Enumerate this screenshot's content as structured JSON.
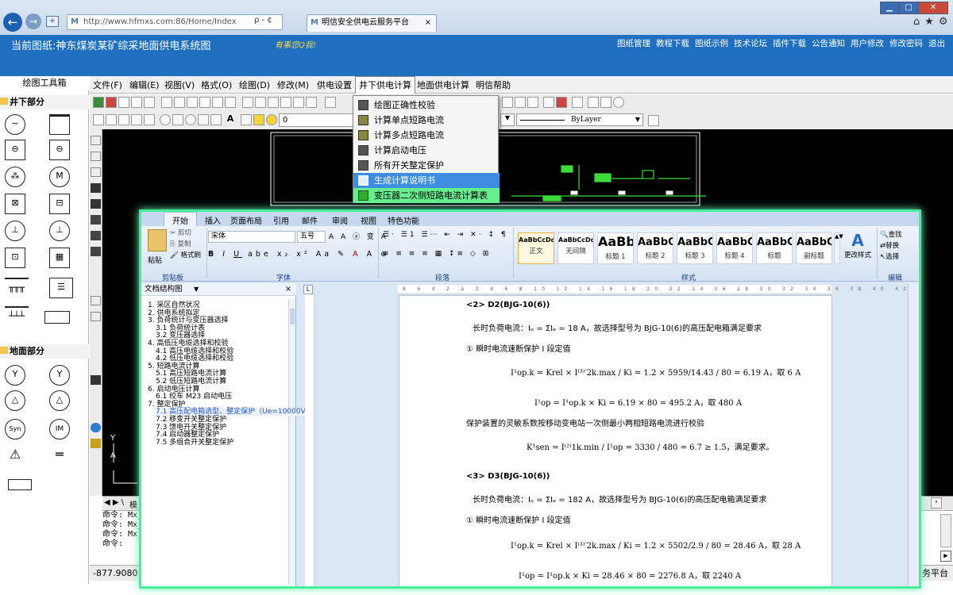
{
  "browser": {
    "url": "http://www.hfmxs.com:86/Home/Index",
    "tab_title": "明信安全供电云服务平台",
    "tab_close": "×",
    "search_glyph": "ρ - ¢"
  },
  "site": {
    "title": "当前图纸:神东煤炭某矿综采地面供电系统图",
    "logo_text": "有事您Q我!",
    "nav": [
      "图纸管理",
      "教程下载",
      "图纸示例",
      "技术论坛",
      "插件下载",
      "公告通知",
      "用户修改",
      "修改密码",
      "退出"
    ]
  },
  "left_panel": {
    "title": "绘图工具箱",
    "section1": "井下部分",
    "section2": "地面部分",
    "symbol_labels": [
      "M",
      "Syn",
      "IM"
    ]
  },
  "cad": {
    "menus": [
      "文件(F)",
      "编辑(E)",
      "视图(V)",
      "格式(O)",
      "绘图(D)",
      "修改(M)",
      "供电设置",
      "井下供电计算",
      "地面供电计算",
      "明信帮助"
    ],
    "layer_value": "0",
    "linetype_value": "ByLayer",
    "dropdown_items": [
      "绘图正确性校验",
      "计算单点短路电流",
      "计算多点短路电流",
      "计算启动电压",
      "所有开关整定保护",
      "生成计算说明书",
      "变压器二次侧短路电流计算表"
    ],
    "selected_item": "生成计算说明书",
    "command_lines": [
      "命令: Mx_",
      "命令: Mx_",
      "命令: Mx_",
      "命令:"
    ],
    "coordinates": "-877.9080",
    "status_right": "服务平台",
    "model_tab": "模"
  },
  "word": {
    "tabs": [
      "开始",
      "插入",
      "页面布局",
      "引用",
      "邮件",
      "审阅",
      "视图",
      "特色功能"
    ],
    "clipboard": {
      "cut": "剪切",
      "copy": "复制",
      "paste": "粘贴",
      "format_painter": "格式刷",
      "group": "剪贴板"
    },
    "font": {
      "name": "宋体",
      "size": "五号",
      "group": "字体"
    },
    "paragraph_group": "段落",
    "styles": [
      {
        "preview": "AaBbCcDd",
        "name": "正文"
      },
      {
        "preview": "AaBbCcDd",
        "name": "无间隔"
      },
      {
        "preview": "AaBb",
        "name": "标题 1"
      },
      {
        "preview": "AaBbC",
        "name": "标题 2"
      },
      {
        "preview": "AaBbC",
        "name": "标题 3"
      },
      {
        "preview": "AaBbC",
        "name": "标题 4"
      },
      {
        "preview": "AaBbC",
        "name": "标题"
      },
      {
        "preview": "AaBbC",
        "name": "副标题"
      }
    ],
    "styles_group": "样式",
    "change_styles": "更改样式",
    "editing": {
      "find": "查找",
      "replace": "替换",
      "select": "选择",
      "group": "编辑"
    },
    "nav": {
      "title": "文档结构图",
      "items": [
        "1. 采区自然状况",
        "2. 供电系统拟定",
        "3. 负荷统计与变压器选择",
        "3.1 负荷统计表",
        "3.2 变压器选择",
        "4. 高低压电缆选择和校验",
        "4.1 高压电缆选择和校验",
        "4.2 低压电缆选择和校验",
        "5. 短路电流计算",
        "5.1 高压短路电流计算",
        "5.2 低压短路电流计算",
        "6. 启动电压计算",
        "6.1 绞车 M23 启动电压",
        "7. 整定保护",
        "7.1 高压配电箱选型、整定保护（Ue=10000V",
        "7.2 移变开关整定保护",
        "7.3 馈电开关整定保护",
        "7.4 启动器整定保护",
        "7.5 多组合开关整定保护"
      ]
    },
    "doc": {
      "h_d2": "<2> D2(BJG-10(6))",
      "d2_load": "长时负荷电流：Iₒ = ΣIₑ = 18 A，故选择型号为 BJG-10(6)的高压配电箱满足要求",
      "d2_instant": "① 瞬时电流速断保护 I 段定值",
      "d2_f1": "I¹op.k = Krel × I⁽³⁾′2k.max / Ki = 1.2 × 5959/14.43 / 80 = 6.19 A，取 6 A",
      "d2_f2": "I¹op = I¹op.k × Ki = 6.19 × 80 = 495.2 A，取 480 A",
      "d2_sens": "保护装置的灵敏系数按移动变电站一次侧最小两相短路电流进行校验",
      "d2_f3": "K¹sen = I⁽²⁾1k.min / I¹op = 3330 / 480 = 6.7 ≥ 1.5，满足要求。",
      "h_d3": "<3> D3(BJG-10(6))",
      "d3_load": "长时负荷电流：Iₒ = ΣIₑ = 182 A，故选择型号为 BJG-10(6)的高压配电箱满足要求",
      "d3_instant": "① 瞬时电流速断保护 I 段定值",
      "d3_f1": "I¹op.k = Krel × I⁽³⁾′2k.max / Ki = 1.2 × 5502/2.9 / 80 = 28.46 A，取 28 A",
      "d3_f2": "I¹op = I¹op.k × Ki = 28.46 × 80 = 2276.8 A，取 2240 A"
    }
  }
}
